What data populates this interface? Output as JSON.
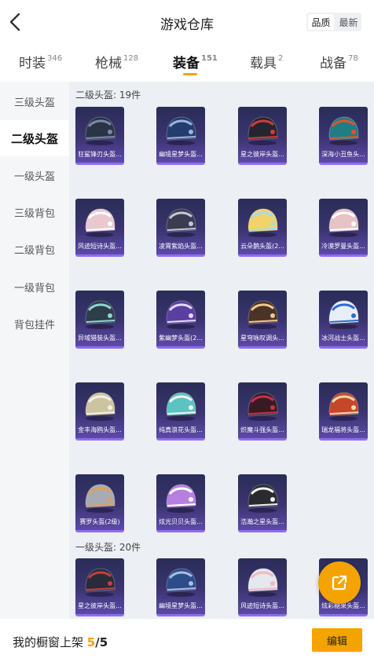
{
  "header": {
    "title": "游戏仓库",
    "sort_quality": "品质",
    "sort_latest": "最新"
  },
  "tabs": [
    {
      "label": "时装",
      "count": "346"
    },
    {
      "label": "枪械",
      "count": "128"
    },
    {
      "label": "装备",
      "count": "151",
      "active": true
    },
    {
      "label": "载具",
      "count": "2"
    },
    {
      "label": "战备",
      "count": "78"
    }
  ],
  "sidebar": [
    {
      "label": "三级头盔"
    },
    {
      "label": "二级头盔",
      "active": true
    },
    {
      "label": "一级头盔"
    },
    {
      "label": "三级背包"
    },
    {
      "label": "二级背包"
    },
    {
      "label": "一级背包"
    },
    {
      "label": "背包挂件"
    }
  ],
  "sections": [
    {
      "label": "二级头盔: 19件",
      "items": [
        {
          "name": "狂鲨锋刃头盔...",
          "color": "#2b3346",
          "accent": "#7a8aa6"
        },
        {
          "name": "幽境星梦头盔...",
          "color": "#223d6e",
          "accent": "#9fb4d9"
        },
        {
          "name": "星之彼岸头盔...",
          "color": "#252531",
          "accent": "#d23a3a"
        },
        {
          "name": "深海小丑鱼头...",
          "color": "#1f7d86",
          "accent": "#e0542a"
        },
        {
          "name": "风迹短诗头盔...",
          "color": "#e9c9cf",
          "accent": "#ffffff"
        },
        {
          "name": "凌霄紫焰头盔...",
          "color": "#3b3b52",
          "accent": "#c6c6d6"
        },
        {
          "name": "云朵鹅头盔(2...",
          "color": "#f1d36a",
          "accent": "#a9d9ef"
        },
        {
          "name": "冷漠罗曼头盔...",
          "color": "#e7c3c6",
          "accent": "#ffffff"
        },
        {
          "name": "异域猎装头盔...",
          "color": "#2d3d4a",
          "accent": "#8fd4d1"
        },
        {
          "name": "紫幽梦头盔(2...",
          "color": "#5a3fa0",
          "accent": "#e3d7ff"
        },
        {
          "name": "星穹咏叹调头...",
          "color": "#4a3426",
          "accent": "#f0c88f"
        },
        {
          "name": "冰河战士头盔...",
          "color": "#e8eef7",
          "accent": "#2c6bd1"
        },
        {
          "name": "金丰海鸥头盔...",
          "color": "#ccc4a1",
          "accent": "#f3efe2"
        },
        {
          "name": "纯真浪花头盔...",
          "color": "#5cc3c3",
          "accent": "#f6f0e8"
        },
        {
          "name": "炽魔斗强头盔...",
          "color": "#3a1a22",
          "accent": "#c2324b"
        },
        {
          "name": "瑞龙福将头盔...",
          "color": "#c7462a",
          "accent": "#f1d9a8"
        },
        {
          "name": "赛罗头盔(2级)",
          "color": "#a8abb3",
          "accent": "#d9a063"
        },
        {
          "name": "炫光贝贝头盔...",
          "color": "#b77fe0",
          "accent": "#ffffff"
        },
        {
          "name": "浩瀚之星头盔...",
          "color": "#2a2a30",
          "accent": "#f2f2f2"
        }
      ]
    },
    {
      "label": "一级头盔: 20件",
      "items": [
        {
          "name": "星之彼岸头盔...",
          "color": "#2a2a3a",
          "accent": "#c23f3f"
        },
        {
          "name": "幽境星梦头盔...",
          "color": "#2c4d8a",
          "accent": "#a9bde3"
        },
        {
          "name": "风迹短诗头盔...",
          "color": "#e5e8ee",
          "accent": "#f0b9c2"
        },
        {
          "name": "炫彩糖果头盔...",
          "color": "#9a7ad7",
          "accent": "#f7f3ff"
        }
      ]
    }
  ],
  "bottom": {
    "showcase_label": "我的橱窗上架",
    "showcase_count": "5",
    "showcase_total": "/5",
    "edit_label": "编辑"
  },
  "icons": {
    "back": "chevron-left-icon",
    "share": "share-external-icon"
  },
  "colors": {
    "accent": "#f5a300",
    "card_border": "#8f6cf0"
  }
}
